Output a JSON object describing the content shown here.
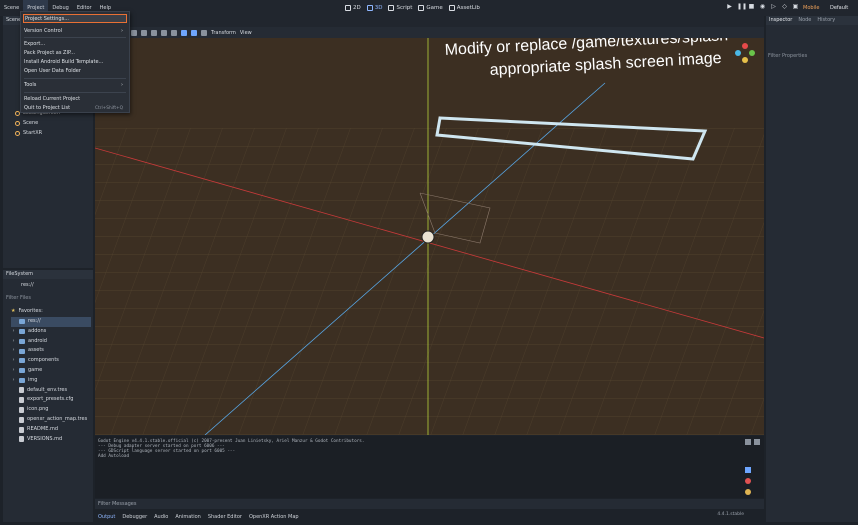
{
  "menubar": {
    "items": [
      "Scene",
      "Project",
      "Debug",
      "Editor",
      "Help"
    ]
  },
  "workspaces": [
    "2D",
    "3D",
    "Script",
    "Game",
    "AssetLib"
  ],
  "renderer": "Mobile",
  "layout_name": "Default",
  "scene_dock": {
    "tab": "Scene",
    "nodes": [
      {
        "label": "LoadingScreen"
      },
      {
        "label": "Scene"
      },
      {
        "label": "StartXR"
      }
    ]
  },
  "viewport_toolbar": {
    "transform": "Transform",
    "view": "View"
  },
  "viewport_text": {
    "line1": "Modify or replace /game/textures/splash",
    "line2": "appropriate splash screen image"
  },
  "filesystem": {
    "tab": "FileSystem",
    "path": "res://",
    "filter_placeholder": "Filter Files",
    "favorites": "Favorites:",
    "items": [
      {
        "label": "res://",
        "type": "folder",
        "selected": true
      },
      {
        "label": "addons",
        "type": "folder"
      },
      {
        "label": "android",
        "type": "folder"
      },
      {
        "label": "assets",
        "type": "folder"
      },
      {
        "label": "components",
        "type": "folder"
      },
      {
        "label": "game",
        "type": "folder"
      },
      {
        "label": "img",
        "type": "folder"
      },
      {
        "label": "default_env.tres",
        "type": "file"
      },
      {
        "label": "export_presets.cfg",
        "type": "file"
      },
      {
        "label": "icon.png",
        "type": "file"
      },
      {
        "label": "openxr_action_map.tres",
        "type": "file"
      },
      {
        "label": "README.md",
        "type": "file"
      },
      {
        "label": "VERSIONS.md",
        "type": "file"
      }
    ]
  },
  "inspector": {
    "tabs": [
      "Inspector",
      "Node",
      "History"
    ],
    "filter_placeholder": "Filter Properties"
  },
  "output": {
    "lines": [
      "Godot Engine v4.4.1.stable.official (c) 2007-present Juan Linietsky, Ariel Manzur & Godot Contributors.",
      "--- Debug adapter server started on port 6006 ---",
      "--- GDScript language server started on port 6005 ---",
      "Add Autoload"
    ],
    "filter_placeholder": "Filter Messages",
    "tabs": [
      "Output",
      "Debugger",
      "Audio",
      "Animation",
      "Shader Editor",
      "OpenXR Action Map"
    ],
    "version": "4.4.1.stable"
  },
  "project_menu": {
    "items": [
      {
        "label": "Project Settings...",
        "highlight": true
      },
      {
        "label": "Version Control",
        "submenu": true
      },
      {
        "label": "Export..."
      },
      {
        "label": "Pack Project as ZIP..."
      },
      {
        "label": "Install Android Build Template..."
      },
      {
        "label": "Open User Data Folder"
      },
      {
        "label": "Tools",
        "submenu": true
      },
      {
        "label": "Reload Current Project"
      },
      {
        "label": "Quit to Project List",
        "shortcut": "Ctrl+Shift+Q"
      }
    ]
  },
  "colors": {
    "accent": "#6ea6ff",
    "highlight_border": "#e97034",
    "splash_box": "#cfe6f0"
  }
}
